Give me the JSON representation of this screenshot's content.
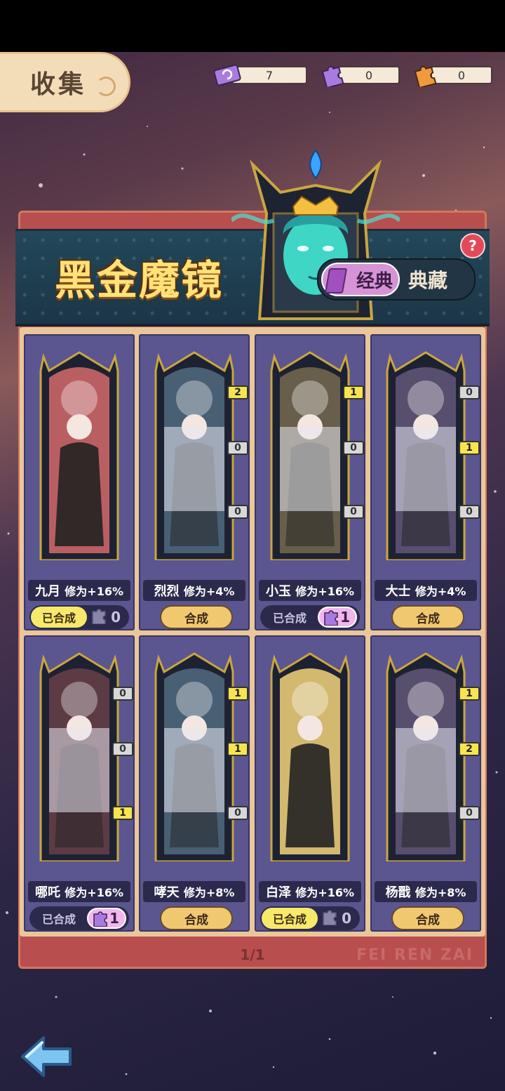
{
  "header": {
    "collect_label": "收集",
    "currencies": [
      {
        "icon": "ticket-icon",
        "value": "7"
      },
      {
        "icon": "purple-puzzle-icon",
        "value": "0"
      },
      {
        "icon": "orange-puzzle-icon",
        "value": "0"
      }
    ]
  },
  "album": {
    "title": "黑金魔镜",
    "help": "?",
    "tabs": [
      {
        "label": "经典",
        "active": true
      },
      {
        "label": "典藏",
        "active": false
      }
    ]
  },
  "cards": [
    {
      "name": "九月",
      "bonus": "修为+16%",
      "state": "done",
      "done_label": "已合成",
      "pieces": "0",
      "badges": []
    },
    {
      "name": "烈烈",
      "bonus": "修为+4%",
      "state": "merge",
      "merge_label": "合成",
      "badges": [
        "2",
        "0",
        "0"
      ]
    },
    {
      "name": "小玉",
      "bonus": "修为+16%",
      "state": "done",
      "done_label": "已合成",
      "pieces": "1",
      "badges": [
        "1",
        "0",
        "0"
      ]
    },
    {
      "name": "大士",
      "bonus": "修为+4%",
      "state": "merge",
      "merge_label": "合成",
      "badges": [
        "0",
        "1",
        "0"
      ]
    },
    {
      "name": "哪吒",
      "bonus": "修为+16%",
      "state": "done",
      "done_label": "已合成",
      "pieces": "1",
      "badges": [
        "0",
        "0",
        "1"
      ]
    },
    {
      "name": "哮天",
      "bonus": "修为+8%",
      "state": "merge",
      "merge_label": "合成",
      "badges": [
        "1",
        "1",
        "0"
      ]
    },
    {
      "name": "白泽",
      "bonus": "修为+16%",
      "state": "done",
      "done_label": "已合成",
      "pieces": "0",
      "badges": []
    },
    {
      "name": "杨戬",
      "bonus": "修为+8%",
      "state": "merge",
      "merge_label": "合成",
      "badges": [
        "1",
        "2",
        "0"
      ]
    }
  ],
  "footer": {
    "page": "1/1",
    "watermark": "FEI REN ZAI"
  },
  "colors": {
    "title_gold": "#ffe27a",
    "card_bg": "#5b5590",
    "merge_button": "#f0c870",
    "done_badge": "#f7e96a",
    "piece_badge_active": "#f7e450",
    "panel_red": "#b84e4e"
  }
}
